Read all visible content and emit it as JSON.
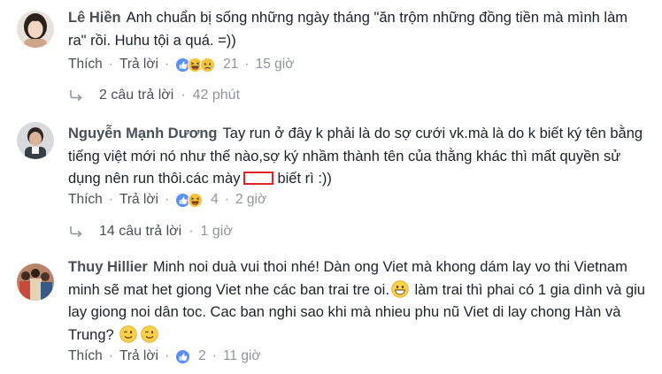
{
  "comments": [
    {
      "author": "Lê Hiền",
      "text": "Anh chuẩn bị sống những ngày tháng \"ăn trộm những đồng tiền mà mình làm ra\" rồi. Huhu tội a quá. =))",
      "like_label": "Thích",
      "reply_label": "Trả lời",
      "reaction_count": "21",
      "time": "15 giờ",
      "replies_label": "2 câu trả lời",
      "replies_time": "42 phút"
    },
    {
      "author": "Nguyễn Mạnh Dương",
      "text_before": "Tay run ở đây k phải là do sợ cưới vk.mà là do k biết ký tên bằng tiếng việt mới nó như thế nào,sợ ký nhầm thành tên của thằng khác thì mất quyền sử dụng nên run thôi.các mày",
      "text_after": "biết rì :))",
      "like_label": "Thích",
      "reply_label": "Trả lời",
      "reaction_count": "4",
      "time": "2 giờ",
      "replies_label": "14 câu trả lời",
      "replies_time": "1 giờ"
    },
    {
      "author": "Thuy Hillier",
      "text_part1": "Minh noi duà vui thoi nhé! Dàn ong Viet mà khong dám lay vo thi Vietnam minh sẽ mat het giong Viet nhe các ban trai tre oi.",
      "text_part2": "làm trai thì phai có 1 gia dình và giu lay giong noi dân toc. Cac ban nghi sao khi mà nhieu phu nũ Viet di lay chong Hàn và Trung?",
      "like_label": "Thích",
      "reply_label": "Trả lời",
      "reaction_count": "2",
      "time": "11 giờ"
    }
  ],
  "colors": {
    "link": "#4b4f56",
    "meta": "#90949c",
    "like_blue": "#5890ff",
    "haha_yellow": "#f7c33d",
    "redaction": "#e02424"
  },
  "icons": [
    "like-reaction-icon",
    "haha-reaction-icon",
    "sad-reaction-icon",
    "reply-arrow-icon",
    "grin-emoji-icon",
    "wink-emoji-icon"
  ]
}
